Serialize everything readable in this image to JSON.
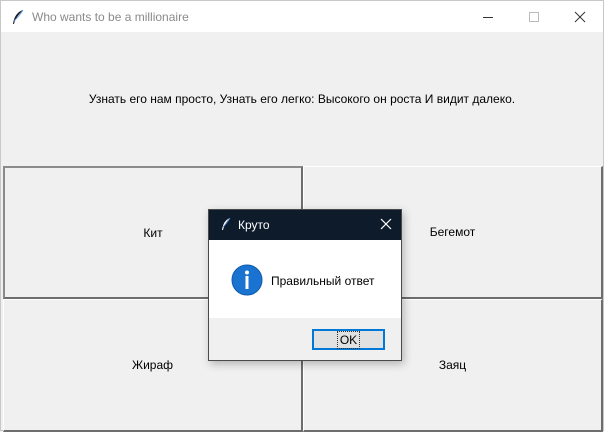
{
  "window": {
    "title": "Who wants to be a millionaire",
    "icon": "feather-icon"
  },
  "question": {
    "text": "Узнать его нам просто, Узнать его легко: Высокого он роста И видит далеко."
  },
  "answers": [
    {
      "label": "Кит"
    },
    {
      "label": "Бегемот"
    },
    {
      "label": "Жираф"
    },
    {
      "label": "Заяц"
    }
  ],
  "dialog": {
    "title": "Круто",
    "icon": "feather-icon",
    "message": "Правильный ответ",
    "message_icon": "info-icon",
    "ok_label": "OK"
  },
  "colors": {
    "dialog_titlebar": "#0d1b2a",
    "info_blue": "#1a73d1",
    "focus_border": "#0078d7"
  }
}
